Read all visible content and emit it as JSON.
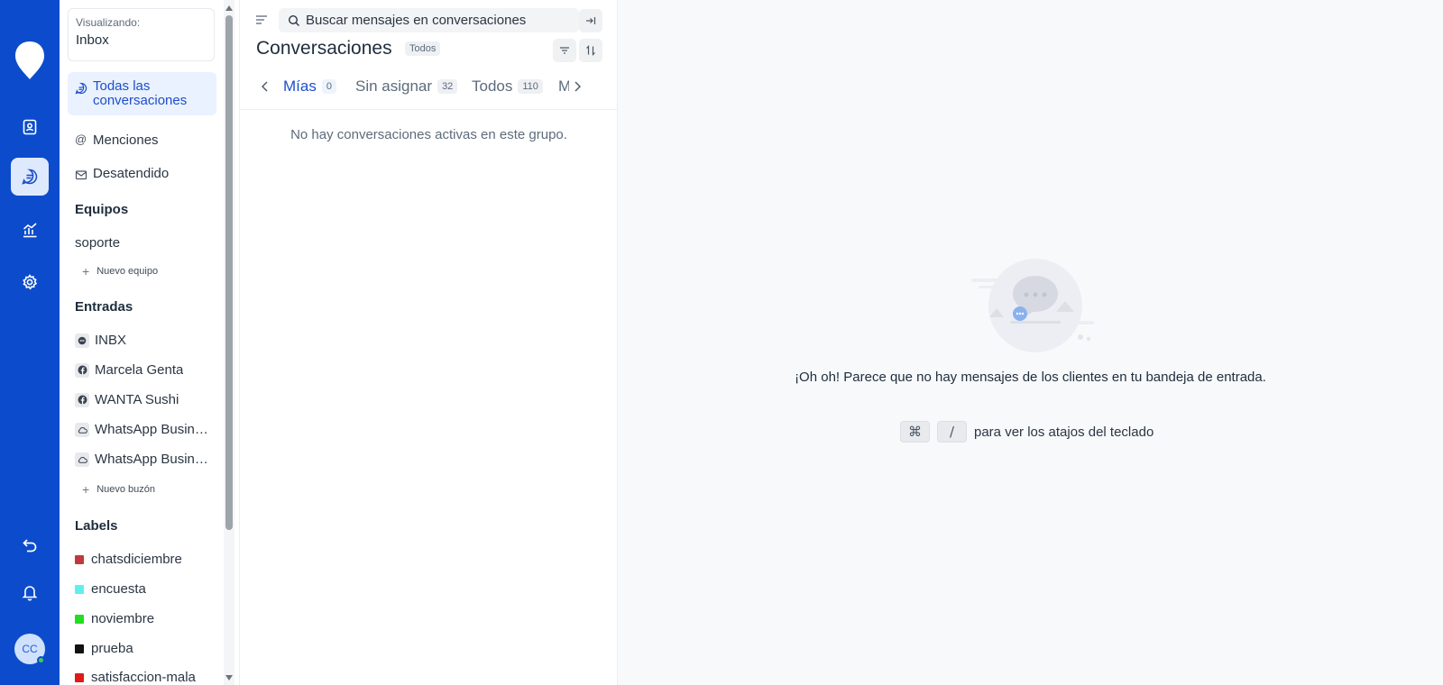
{
  "rail": {
    "avatar_initials": "CC",
    "colors": {
      "background": "#0c4ccc",
      "active_bg": "#dfe9fd",
      "online": "#44c662"
    },
    "items": [
      "contacts-icon",
      "conversations-icon",
      "reports-icon",
      "settings-icon"
    ],
    "bottom": [
      "undo-icon",
      "notifications-icon"
    ]
  },
  "sidebar": {
    "viewing_label": "Visualizando:",
    "viewing_value": "Inbox",
    "nav": [
      {
        "label": "Todas las conversaciones",
        "icon": "chat-bubble-icon",
        "active": true
      },
      {
        "label": "Menciones",
        "icon": "at-icon"
      },
      {
        "label": "Desatendido",
        "icon": "mail-icon"
      }
    ],
    "teams_title": "Equipos",
    "teams": [
      "soporte"
    ],
    "new_team": "Nuevo equipo",
    "inboxes_title": "Entradas",
    "inboxes": [
      {
        "label": "INBX",
        "icon": "chat-icon"
      },
      {
        "label": "Marcela Genta",
        "icon": "facebook-icon"
      },
      {
        "label": "WANTA Sushi",
        "icon": "facebook-icon"
      },
      {
        "label": "WhatsApp Business",
        "icon": "cloud-icon"
      },
      {
        "label": "WhatsApp Business",
        "icon": "cloud-icon"
      }
    ],
    "new_inbox": "Nuevo buzón",
    "labels_title": "Labels",
    "labels": [
      {
        "label": "chatsdiciembre",
        "color": "#c0393d"
      },
      {
        "label": "encuesta",
        "color": "#5ef0f0"
      },
      {
        "label": "noviembre",
        "color": "#22dd22"
      },
      {
        "label": "prueba",
        "color": "#111111"
      },
      {
        "label": "satisfaccion-mala",
        "color": "#e01a1a"
      }
    ]
  },
  "conversations": {
    "search_placeholder": "Buscar mensajes en conversaciones",
    "title": "Conversaciones",
    "status_pill": "Todos",
    "tabs": [
      {
        "label": "Mías",
        "count": "0",
        "active": true
      },
      {
        "label": "Sin asignar",
        "count": "32"
      },
      {
        "label": "Todos",
        "count": "110"
      },
      {
        "label": "M"
      }
    ],
    "empty_message": "No hay conversaciones activas en este grupo."
  },
  "main": {
    "empty_message": "¡Oh oh! Parece que no hay mensajes de los clientes en tu bandeja de entrada.",
    "shortcut_keys": [
      "⌘",
      "/"
    ],
    "shortcut_text": "para ver los atajos del teclado"
  }
}
